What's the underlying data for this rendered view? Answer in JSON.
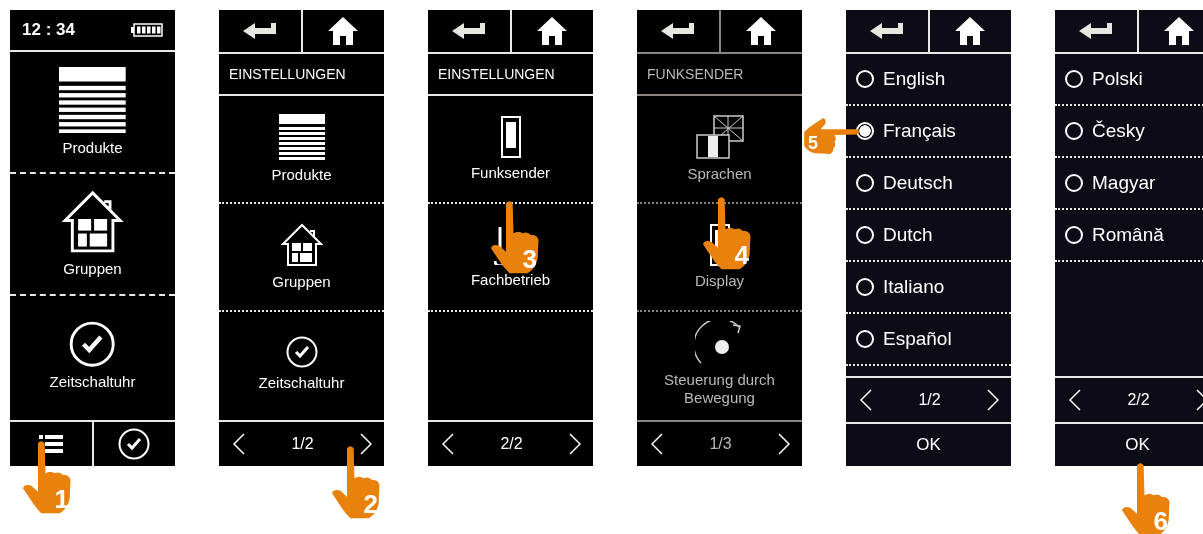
{
  "screens": [
    {
      "kind": "home",
      "dimmed": false,
      "time": "12 : 34",
      "items": [
        {
          "kind": "blind",
          "label": "Produkte"
        },
        {
          "kind": "house",
          "label": "Gruppen"
        },
        {
          "kind": "timer",
          "label": "Zeitschaltuhr"
        }
      ],
      "step": "1"
    },
    {
      "kind": "menu",
      "dimmed": false,
      "title": "EINSTELLUNGEN",
      "items": [
        {
          "kind": "blind",
          "label": "Produkte"
        },
        {
          "kind": "house",
          "label": "Gruppen"
        },
        {
          "kind": "timer",
          "label": "Zeitschaltuhr"
        }
      ],
      "page": "1/2",
      "step": "2"
    },
    {
      "kind": "menu",
      "dimmed": false,
      "title": "EINSTELLUNGEN",
      "items": [
        {
          "kind": "remote",
          "label": "Funksender"
        },
        {
          "kind": "tools",
          "label": "Fachbetrieb"
        }
      ],
      "page": "2/2",
      "step": "3"
    },
    {
      "kind": "menu",
      "dimmed": true,
      "title": "FUNKSENDER",
      "items": [
        {
          "kind": "flags",
          "label": "Sprachen"
        },
        {
          "kind": "remote",
          "label": "Display"
        },
        {
          "kind": "motion",
          "label": "Steuerung durch Bewegung"
        }
      ],
      "page": "1/3",
      "step": "4"
    },
    {
      "kind": "list",
      "dimmed": false,
      "items": [
        {
          "label": "English",
          "selected": false
        },
        {
          "label": "Français",
          "selected": true
        },
        {
          "label": "Deutsch",
          "selected": false
        },
        {
          "label": "Dutch",
          "selected": false
        },
        {
          "label": "Italiano",
          "selected": false
        },
        {
          "label": "Español",
          "selected": false
        }
      ],
      "page": "1/2",
      "ok": "OK",
      "step": "5"
    },
    {
      "kind": "list",
      "dimmed": false,
      "items": [
        {
          "label": "Polski",
          "selected": false
        },
        {
          "label": "Česky",
          "selected": false
        },
        {
          "label": "Magyar",
          "selected": false
        },
        {
          "label": "Română",
          "selected": false
        }
      ],
      "page": "2/2",
      "ok": "OK",
      "step": "6"
    }
  ]
}
